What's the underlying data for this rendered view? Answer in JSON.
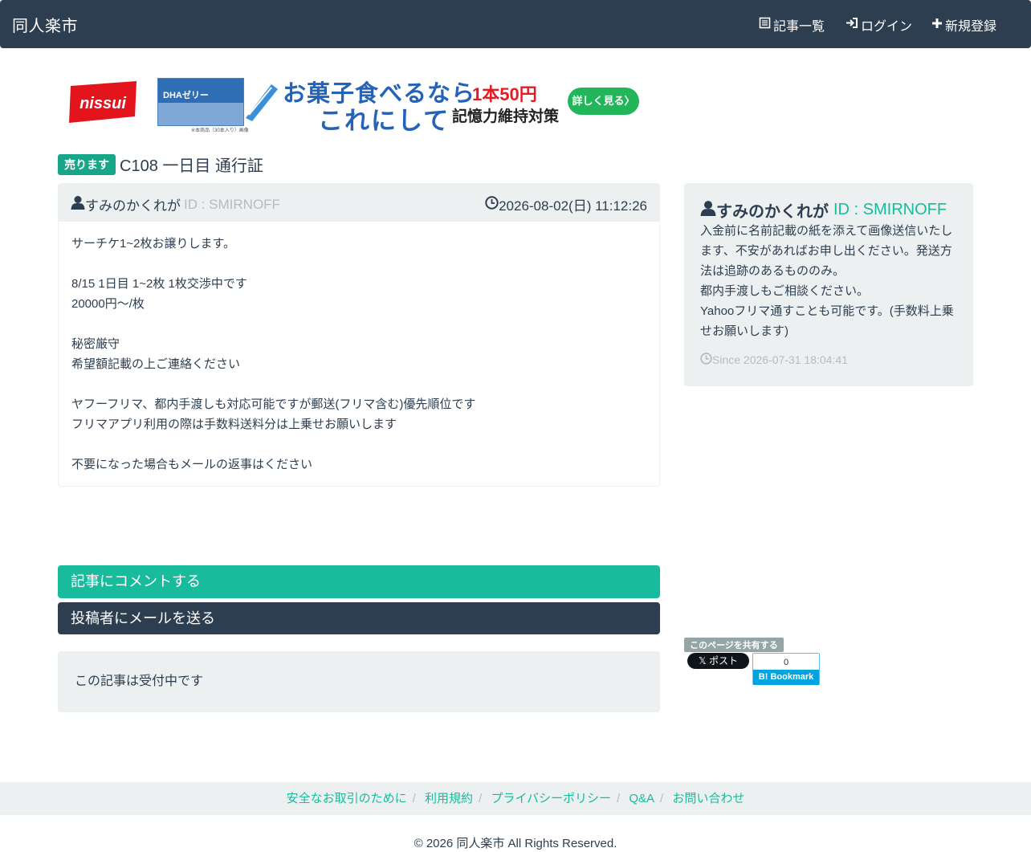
{
  "nav": {
    "brand": "同人楽市",
    "articles": "記事一覧",
    "login": "ログイン",
    "register": "新規登録"
  },
  "ad": {
    "logo_text": "nissui",
    "product_text": "DHAゼリー",
    "tiny_text": "※本商品（30本入り）画像",
    "headline1": "お菓子食べるなら",
    "headline2": "これにして",
    "price": "1本50円",
    "sub": "記憶力維持対策",
    "button": "詳しく見る〉"
  },
  "post": {
    "badge": "売ります",
    "title": "C108 一日目 通行証",
    "user": "すみのかくれが",
    "user_id": "ID : SMIRNOFF",
    "date": "2026-08-02(日) 11:12:26",
    "body": [
      "サーチケ1~2枚お譲りします。",
      "",
      "8/15 1日目 1~2枚 1枚交渉中です",
      "20000円〜/枚",
      "",
      "秘密厳守",
      "希望額記載の上ご連絡ください",
      "",
      "ヤフーフリマ、都内手渡しも対応可能ですが郵送(フリマ含む)優先順位です",
      "フリマアプリ利用の際は手数料送料分は上乗せお願いします",
      "",
      "不要になった場合もメールの返事はください"
    ]
  },
  "profile": {
    "user": "すみのかくれが",
    "user_id": "ID : SMIRNOFF",
    "text": [
      "入金前に名前記載の紙を添えて画像送信いたします、不安があればお申し出ください。発送方法は追跡のあるもののみ。",
      "都内手渡しもご相談ください。",
      "Yahooフリマ通すことも可能です。(手数料上乗せお願いします)"
    ],
    "since": "Since 2026-07-31 18:04:41"
  },
  "actions": {
    "comment": "記事にコメントする",
    "mail": "投稿者にメールを送る"
  },
  "notice": "この記事は受付中です",
  "share": {
    "label": "このページを共有する",
    "x_post": "ポスト",
    "hatena_count": "0",
    "hatena_label": "Bookmark"
  },
  "footer": {
    "links": [
      "安全なお取引のために",
      "利用規約",
      "プライバシーポリシー",
      "Q&A",
      "お問い合わせ"
    ],
    "copyright": "© 2026 同人楽市 All Rights Reserved."
  },
  "colors": {
    "navbar": "#2c3e50",
    "accent": "#18bc9c",
    "muted": "#b4bcc2",
    "panel": "#ecf0f1"
  }
}
